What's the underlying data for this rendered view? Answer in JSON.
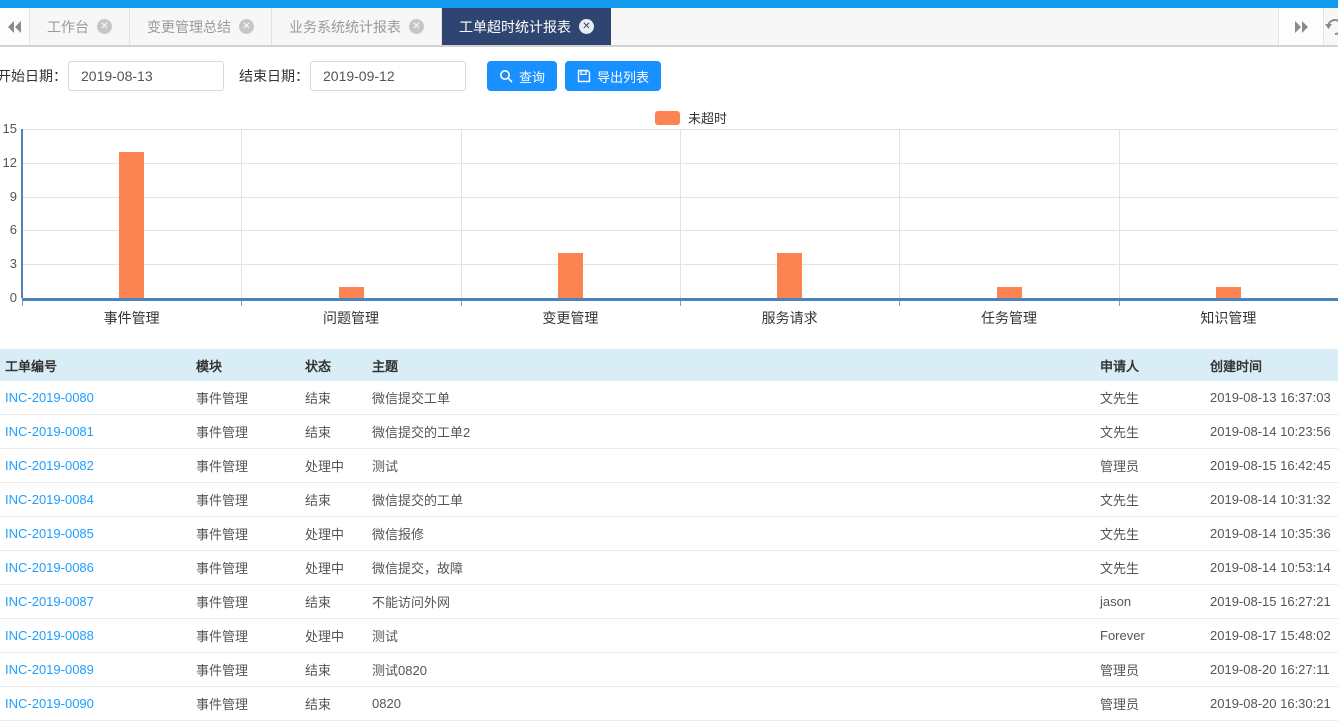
{
  "tabbar": {
    "tabs": [
      {
        "label": "工作台",
        "active": false
      },
      {
        "label": "变更管理总结",
        "active": false
      },
      {
        "label": "业务系统统计报表",
        "active": false
      },
      {
        "label": "工单超时统计报表",
        "active": true
      }
    ]
  },
  "filters": {
    "start_label": "开始日期：",
    "start_value": "2019-08-13",
    "end_label": "结束日期：",
    "end_value": "2019-09-12",
    "search_label": "查询",
    "export_label": "导出列表"
  },
  "chart_data": {
    "type": "bar",
    "title": "",
    "xlabel": "",
    "ylabel": "",
    "categories": [
      "事件管理",
      "问题管理",
      "变更管理",
      "服务请求",
      "任务管理",
      "知识管理"
    ],
    "series": [
      {
        "name": "未超时",
        "values": [
          13,
          1,
          4,
          4,
          1,
          1
        ]
      }
    ],
    "ylim": [
      0,
      15
    ],
    "yticks": [
      0,
      3,
      6,
      9,
      12,
      15
    ],
    "grid": true,
    "legend": [
      {
        "name": "未超时",
        "color": "#fc8452"
      }
    ],
    "legend_position": "top-center",
    "bar_color": "#fc8452",
    "axis_color": "#4d83bd"
  },
  "table": {
    "headers": [
      "工单编号",
      "模块",
      "状态",
      "主题",
      "申请人",
      "创建时间"
    ],
    "rows": [
      [
        "INC-2019-0080",
        "事件管理",
        "结束",
        "微信提交工单",
        "文先生",
        "2019-08-13 16:37:03"
      ],
      [
        "INC-2019-0081",
        "事件管理",
        "结束",
        "微信提交的工单2",
        "文先生",
        "2019-08-14 10:23:56"
      ],
      [
        "INC-2019-0082",
        "事件管理",
        "处理中",
        "测试",
        "管理员",
        "2019-08-15 16:42:45"
      ],
      [
        "INC-2019-0084",
        "事件管理",
        "结束",
        "微信提交的工单",
        "文先生",
        "2019-08-14 10:31:32"
      ],
      [
        "INC-2019-0085",
        "事件管理",
        "处理中",
        "微信报修",
        "文先生",
        "2019-08-14 10:35:36"
      ],
      [
        "INC-2019-0086",
        "事件管理",
        "处理中",
        "微信提交，故障",
        "文先生",
        "2019-08-14 10:53:14"
      ],
      [
        "INC-2019-0087",
        "事件管理",
        "结束",
        "不能访问外网",
        "jason",
        "2019-08-15 16:27:21"
      ],
      [
        "INC-2019-0088",
        "事件管理",
        "处理中",
        "测试",
        "Forever",
        "2019-08-17 15:48:02"
      ],
      [
        "INC-2019-0089",
        "事件管理",
        "结束",
        "测试0820",
        "管理员",
        "2019-08-20 16:27:11"
      ],
      [
        "INC-2019-0090",
        "事件管理",
        "结束",
        "0820",
        "管理员",
        "2019-08-20 16:30:21"
      ]
    ]
  },
  "colors": {
    "topstrip": "#149bf0",
    "active_tab": "#2e4571",
    "button": "#1890ff",
    "link": "#1e9fff",
    "header_bg": "#d9edf7",
    "bar": "#fc8452",
    "axis": "#4d83bd"
  }
}
